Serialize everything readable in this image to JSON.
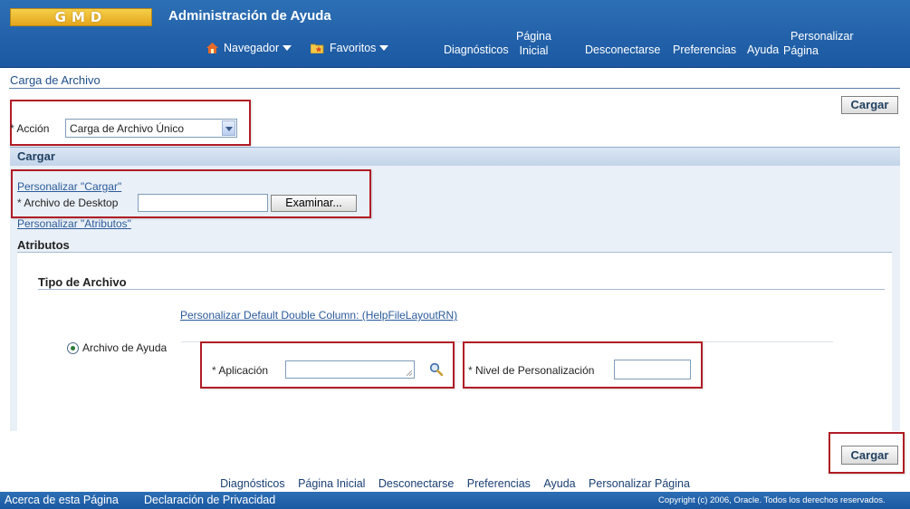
{
  "header": {
    "logo_text": "GMD",
    "app_title": "Administración de Ayuda",
    "nav_menu": "Navegador",
    "favorites_menu": "Favoritos",
    "diagnostics": "Diagnósticos",
    "home_top": "Página",
    "home_bottom": "Inicial",
    "logout": "Desconectarse",
    "preferences": "Preferencias",
    "help": "Ayuda",
    "personalize_top": "Personalizar",
    "personalize_bottom": "Página"
  },
  "page": {
    "title": "Carga de Archivo",
    "upload_button": "Cargar"
  },
  "action": {
    "label": "Acción",
    "selected": "Carga de Archivo Único"
  },
  "region": {
    "title": "Cargar",
    "personalize_upload": "Personalizar \"Cargar\"",
    "desktop_file_label": "Archivo de Desktop",
    "browse_button": "Examinar...",
    "personalize_attributes": "Personalizar \"Atributos\"",
    "attributes_title": "Atributos",
    "file_type_title": "Tipo de Archivo",
    "personalize_double_column": "Personalizar Default Double Column: (HelpFileLayoutRN)",
    "radio_help_file": "Archivo de Ayuda",
    "application_label": "Aplicación",
    "personalization_level_label": "Nivel de Personalización",
    "required_mark": "*"
  },
  "footer": {
    "links": [
      "Diagnósticos",
      "Página Inicial",
      "Desconectarse",
      "Preferencias",
      "Ayuda",
      "Personalizar Página"
    ],
    "about": "Acerca de esta Página",
    "privacy": "Declaración de Privacidad",
    "copyright": "Copyright (c) 2006, Oracle. Todos los derechos reservados."
  }
}
